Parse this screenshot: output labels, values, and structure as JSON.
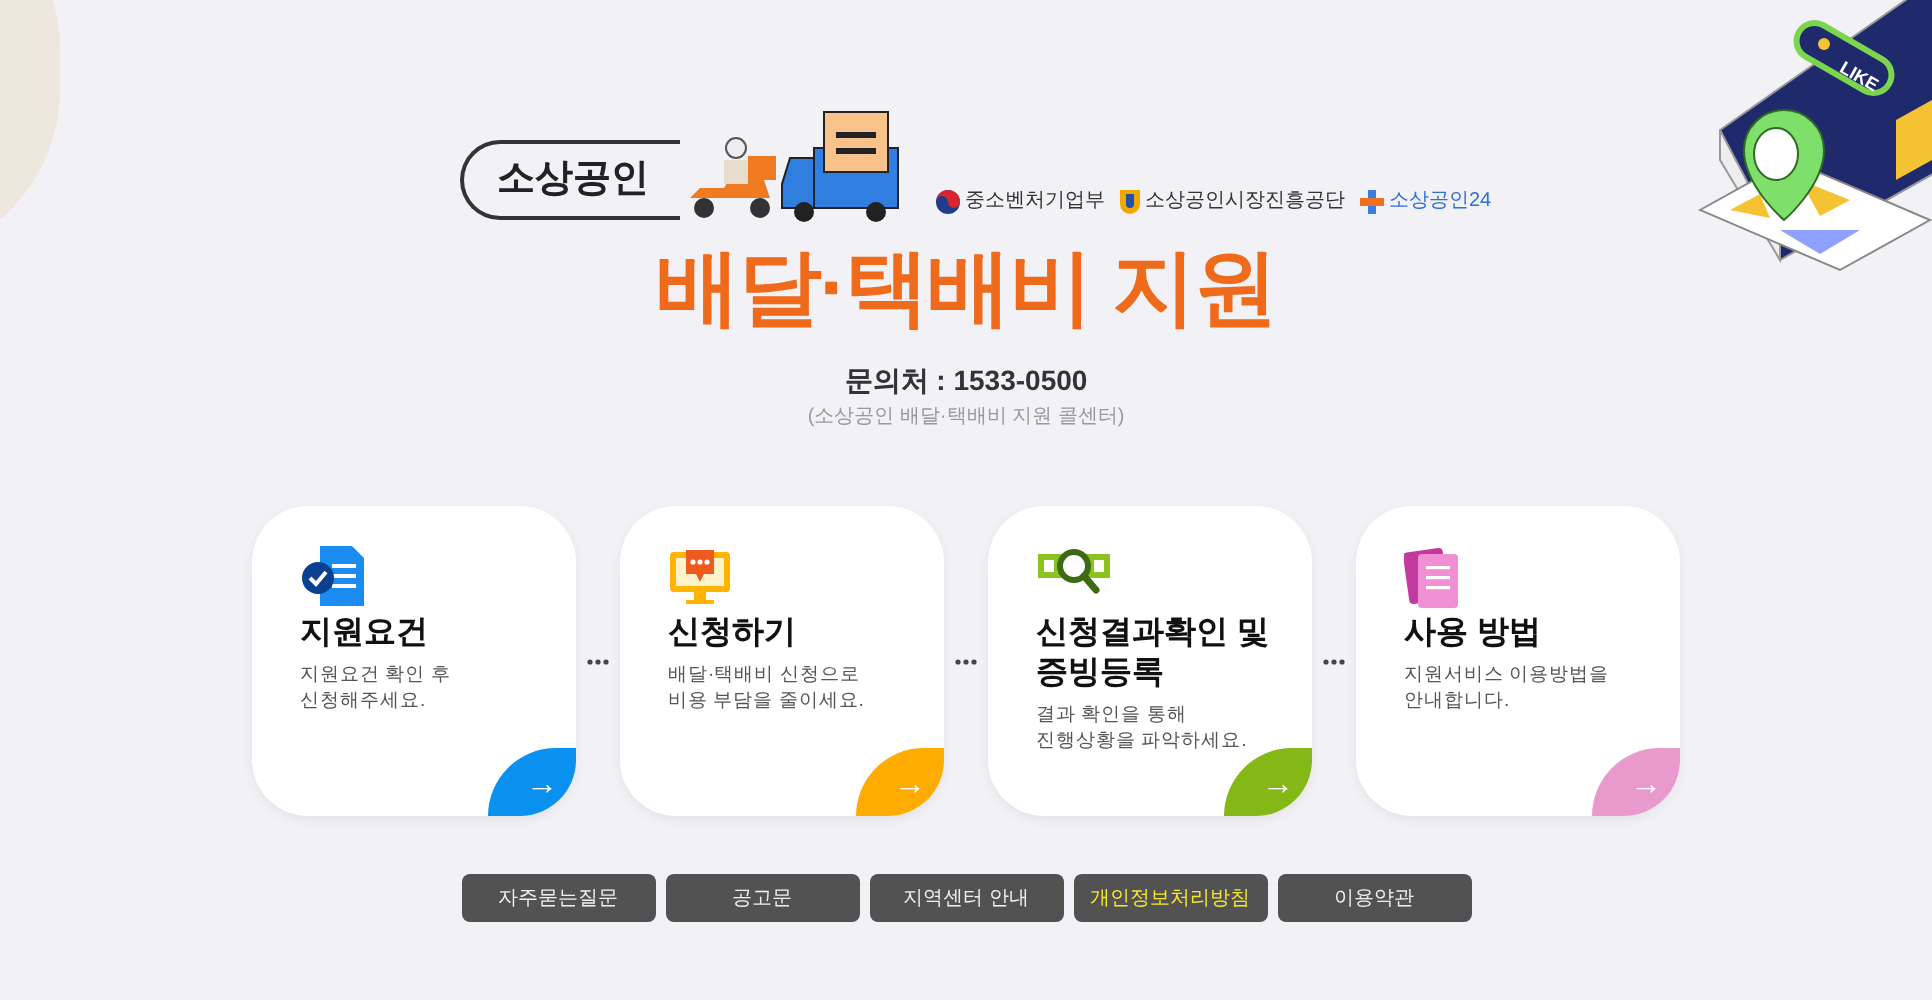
{
  "header": {
    "badge": "소상공인",
    "orgs": [
      {
        "kind": "ministry",
        "label": "중소벤처기업부"
      },
      {
        "kind": "agency",
        "label": "소상공인시장진흥공단"
      },
      {
        "kind": "portal",
        "label": "소상공인24"
      }
    ],
    "title": "배달·택배비 지원",
    "contact": "문의처 : 1533-0500",
    "contact_note": "(소상공인 배달·택배비 지원 콜센터)"
  },
  "illustration": {
    "tag": "LIKE"
  },
  "cards": [
    {
      "kind": "document",
      "title": [
        "지원요건"
      ],
      "desc": [
        "지원요건 확인 후",
        "신청해주세요."
      ],
      "color": "#0a91f0",
      "arrow": "→"
    },
    {
      "kind": "monitor",
      "title": [
        "신청하기"
      ],
      "desc": [
        "배달·택배비 신청으로",
        "비용 부담을 줄이세요."
      ],
      "color": "#ffab00",
      "arrow": "→"
    },
    {
      "kind": "search",
      "title": [
        "신청결과확인 및",
        "증빙등록"
      ],
      "desc": [
        "결과 확인을 통해",
        "진행상황을 파악하세요."
      ],
      "color": "#84b816",
      "arrow": "→"
    },
    {
      "kind": "pages",
      "title": [
        "사용 방법"
      ],
      "desc": [
        "지원서비스 이용방법을",
        "안내합니다."
      ],
      "color": "#e89acd",
      "arrow": "→"
    }
  ],
  "links": [
    {
      "label": "자주묻는질문",
      "highlight": false
    },
    {
      "label": "공고문",
      "highlight": false
    },
    {
      "label": "지역센터 안내",
      "highlight": false
    },
    {
      "label": "개인정보처리방침",
      "highlight": true
    },
    {
      "label": "이용약관",
      "highlight": false
    }
  ]
}
